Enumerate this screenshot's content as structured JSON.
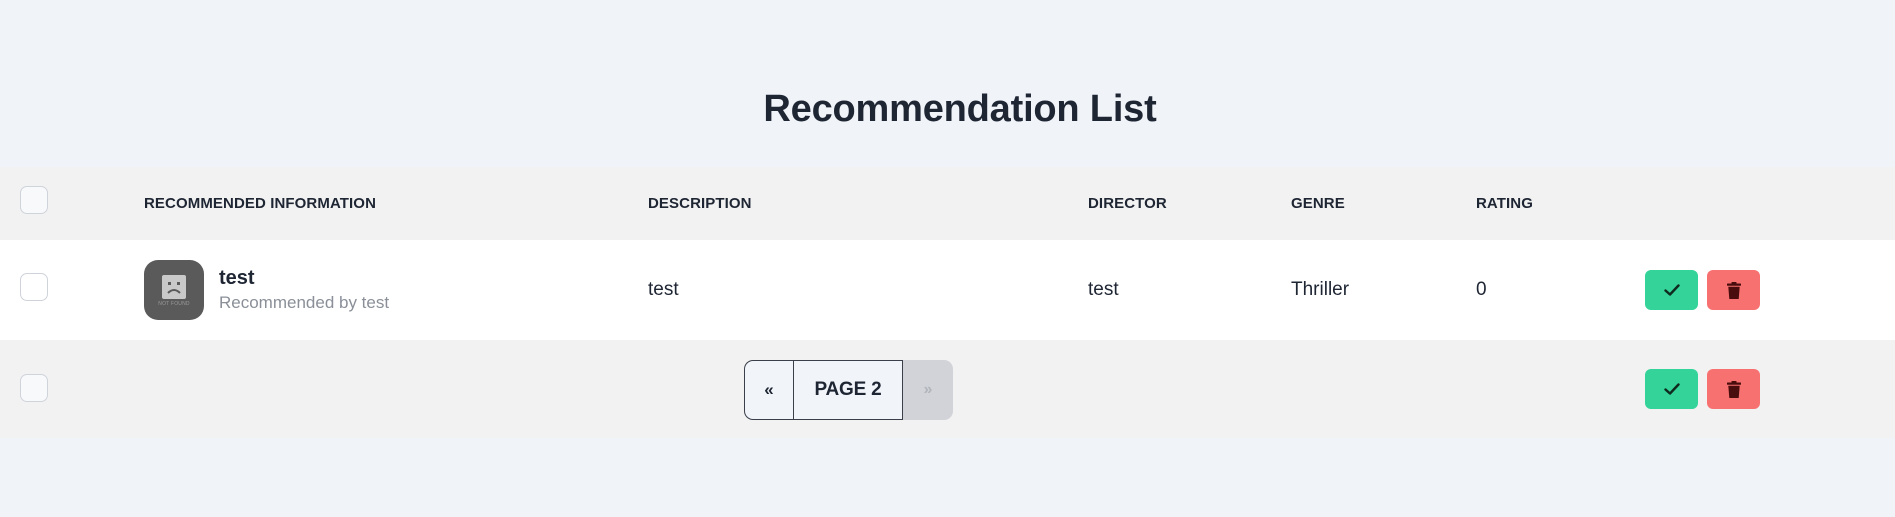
{
  "page": {
    "title": "Recommendation List"
  },
  "table": {
    "headers": {
      "info": "RECOMMENDED INFORMATION",
      "description": "DESCRIPTION",
      "director": "DIRECTOR",
      "genre": "GENRE",
      "rating": "RATING"
    },
    "rows": [
      {
        "title": "test",
        "recommended_by": "Recommended by test",
        "avatar_caption": "NOT FOUND",
        "description": "test",
        "director": "test",
        "genre": "Thriller",
        "rating": "0"
      }
    ]
  },
  "pagination": {
    "prev_label": "«",
    "current_label": "PAGE 2",
    "next_label": "»"
  },
  "icons": {
    "approve": "check-icon",
    "delete": "trash-icon",
    "avatar": "sad-face-icon"
  },
  "colors": {
    "approve": "#34d399",
    "delete": "#f87171",
    "background": "#f0f3f8"
  }
}
